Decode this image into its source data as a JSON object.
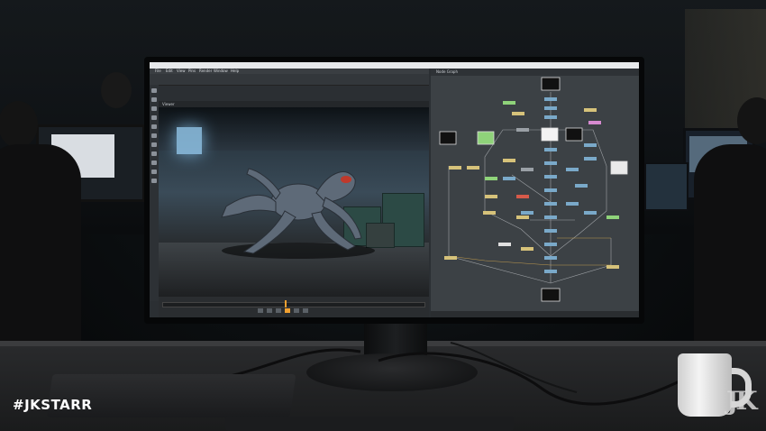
{
  "watermark": "#JKSTARR",
  "logo_text": "JK",
  "screen": {
    "menu": [
      "File",
      "Edit",
      "View",
      "Pins",
      "Render",
      "Window",
      "Help"
    ],
    "viewer_label": "Viewer",
    "graph_tab": "Node Graph"
  },
  "colors": {
    "accent_orange": "#f0a030",
    "node_blue": "#7aa9c9",
    "node_yellow": "#d6c27a",
    "node_green": "#8fd37a",
    "node_red": "#d65a4a"
  }
}
